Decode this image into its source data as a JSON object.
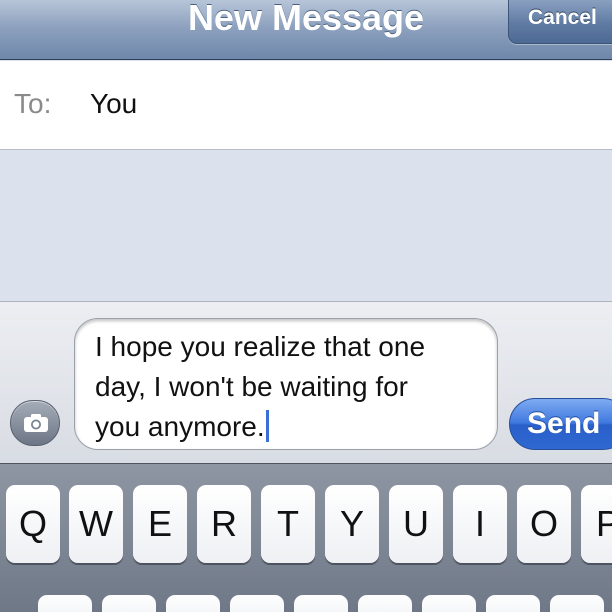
{
  "nav": {
    "title": "New Message",
    "cancel_label": "Cancel"
  },
  "to_field": {
    "label": "To:",
    "recipient": "You"
  },
  "compose": {
    "message_lines": [
      "I hope you realize that one",
      "day, I won't be waiting for",
      "you anymore."
    ],
    "send_label": "Send",
    "camera_icon": "camera-icon"
  },
  "keyboard": {
    "row1": [
      "Q",
      "W",
      "E",
      "R",
      "T",
      "Y",
      "U",
      "I",
      "O",
      "P"
    ]
  },
  "colors": {
    "nav_bar": "#8ea2bf",
    "send_button": "#3f79e0",
    "cursor": "#3a6fd8"
  }
}
